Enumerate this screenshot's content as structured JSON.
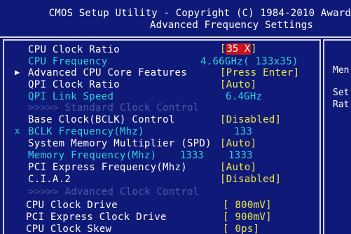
{
  "header": {
    "line1": "CMOS Setup Utility - Copyright (C) 1984-2010 Award",
    "line2": "Advanced Frequency Settings"
  },
  "help_panel": {
    "line1": "Men",
    "line2": "Set",
    "line3": "Rat"
  },
  "settings": {
    "cpu_clock_ratio": {
      "label": "CPU Clock Ratio",
      "open": "[",
      "value": "35 X",
      "close": "]"
    },
    "cpu_frequency": {
      "label": "CPU Frequency",
      "value": "4.66GHz( 133x35)"
    },
    "advanced_cpu_core": {
      "marker": "▶",
      "label": "Advanced CPU Core Features",
      "value": "[Press Enter]"
    },
    "qpi_clock_ratio": {
      "label": "QPI Clock Ratio",
      "value": "[Auto]"
    },
    "qpi_link_speed": {
      "label": "QPI Link Speed",
      "value": "6.4GHz"
    },
    "standard_clock_control": {
      "label": ">>>>> Standard Clock Control"
    },
    "base_clock_control": {
      "label": "Base Clock(BCLK) Control",
      "value": "[Disabled]"
    },
    "bclk_frequency": {
      "marker": "x",
      "label": "BCLK Frequency(Mhz)",
      "value": "133"
    },
    "system_memory_multiplier": {
      "label": "System Memory Multiplier (SPD)",
      "value": "[Auto]"
    },
    "memory_frequency": {
      "label": "Memory Frequency(Mhz)",
      "current": "1333",
      "value": "1333"
    },
    "pci_express_frequency": {
      "label": "PCI Express Frequency(Mhz)",
      "value": "[Auto]"
    },
    "cia2": {
      "label": "C.I.A.2",
      "value": "[Disabled]"
    },
    "advanced_clock_control": {
      "label": ">>>>> Advanced Clock Control"
    },
    "cpu_clock_drive": {
      "label": "CPU Clock Drive",
      "value": "[ 800mV]"
    },
    "pci_express_clock_drive": {
      "label": "PCI Express Clock Drive",
      "value": "[ 900mV]"
    },
    "cpu_clock_skew": {
      "label": "CPU Clock Skew",
      "value": "[    0ps]"
    }
  }
}
